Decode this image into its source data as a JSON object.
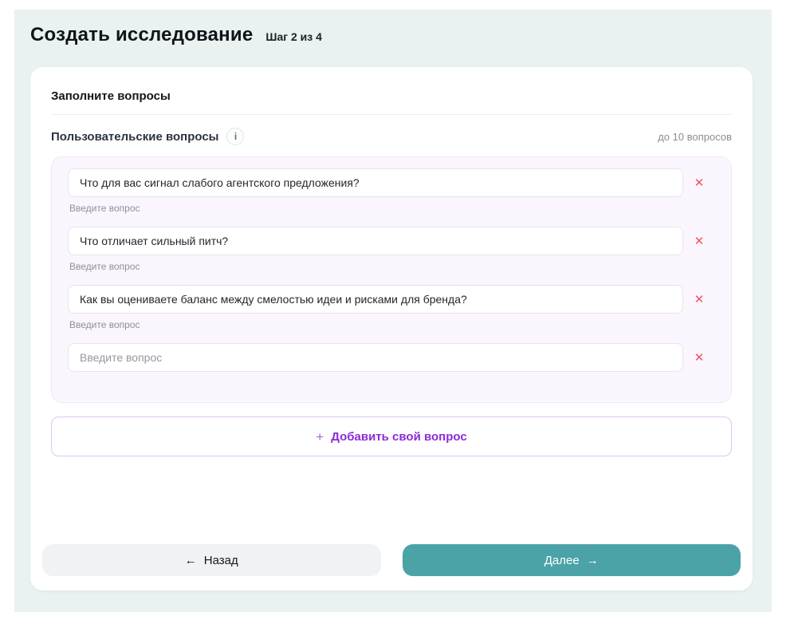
{
  "page": {
    "title": "Создать исследование",
    "step": "Шаг 2 из 4"
  },
  "card": {
    "section_title": "Заполните вопросы",
    "questions_header": {
      "label": "Пользовательские вопросы",
      "info_icon": "i",
      "limit_note": "до 10 вопросов"
    },
    "questions": [
      {
        "value": "Что для вас сигнал слабого агентского предложения?",
        "placeholder": "Введите вопрос",
        "helper": "Введите вопрос"
      },
      {
        "value": "Что отличает сильный питч?",
        "placeholder": "Введите вопрос",
        "helper": "Введите вопрос"
      },
      {
        "value": "Как вы оцениваете баланс между смелостью идеи и рисками для бренда?",
        "placeholder": "Введите вопрос",
        "helper": "Введите вопрос"
      },
      {
        "value": "",
        "placeholder": "Введите вопрос"
      }
    ],
    "remove_icon": "✕",
    "add_button": {
      "plus": "+",
      "label": "Добавить свой вопрос"
    }
  },
  "footer": {
    "back_arrow": "←",
    "back_label": "Назад",
    "next_label": "Далее",
    "next_arrow": "→"
  },
  "colors": {
    "background": "#e9f1f1",
    "accent_teal": "#4ba3a8",
    "accent_purple": "#8c2bda",
    "panel_purple": "#fbf6fd",
    "danger_red": "#f4545c"
  }
}
